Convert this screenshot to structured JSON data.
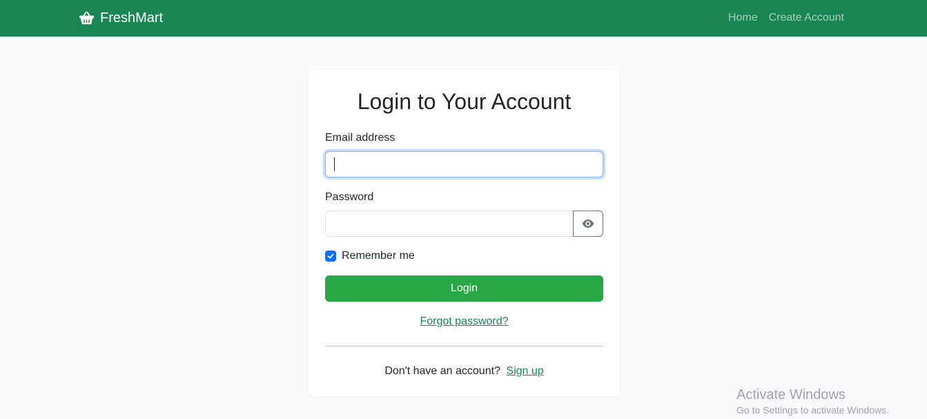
{
  "navbar": {
    "brand": "FreshMart",
    "brand_icon": "basket-icon",
    "links": [
      {
        "label": "Home"
      },
      {
        "label": "Create Account"
      }
    ],
    "color": "#198754"
  },
  "login_form": {
    "title": "Login to Your Account",
    "email_label": "Email address",
    "email_value": "",
    "password_label": "Password",
    "password_value": "",
    "toggle_icon": "eye-icon",
    "remember_label": "Remember me",
    "remember_checked": true,
    "login_button": "Login",
    "forgot_link": "Forgot password?",
    "signup_prompt": "Don't have an account?",
    "signup_link": "Sign up",
    "button_color": "#28a745"
  },
  "watermark": {
    "title": "Activate Windows",
    "subtitle": "Go to Settings to activate Windows."
  }
}
